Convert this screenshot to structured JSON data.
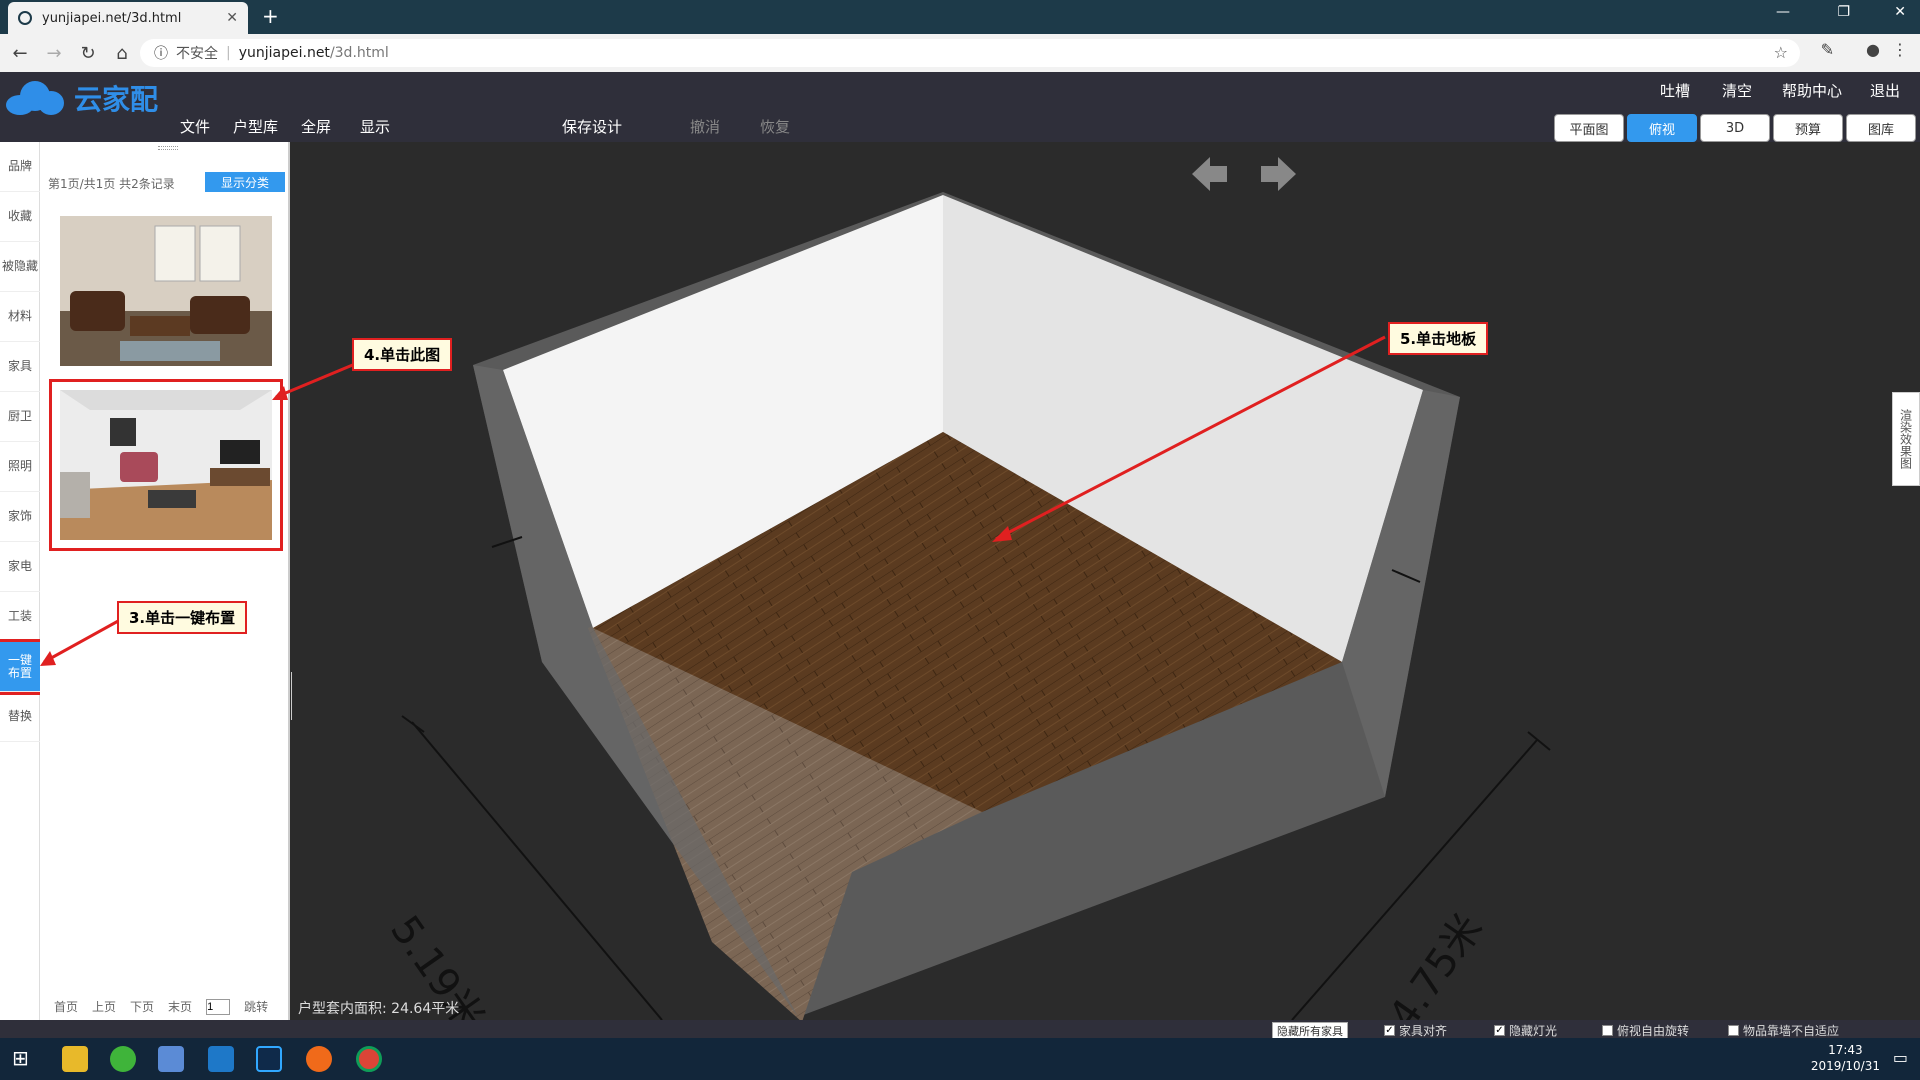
{
  "browser": {
    "tab_title": "yunjiapei.net/3d.html",
    "security_label": "不安全",
    "url_host": "yunjiapei.net",
    "url_path": "/3d.html"
  },
  "app": {
    "logo_text": "云家配",
    "menu": [
      "文件",
      "户型库",
      "全屏",
      "显示"
    ],
    "save": "保存设计",
    "undo": "撤消",
    "redo": "恢复",
    "top_links": [
      "吐槽",
      "清空",
      "帮助中心",
      "退出"
    ],
    "view_tabs": [
      "平面图",
      "俯视",
      "3D",
      "预算",
      "图库"
    ],
    "active_view": "俯视"
  },
  "sidebar": {
    "categories": [
      "品牌",
      "收藏",
      "被隐藏",
      "材料",
      "家具",
      "厨卫",
      "照明",
      "家饰",
      "家电",
      "工装",
      "一键布置",
      "替换"
    ],
    "active": "一键布置"
  },
  "list": {
    "page_info": "第1页/共1页 共2条记录",
    "show_category": "显示分类",
    "pager": {
      "first": "首页",
      "prev": "上页",
      "next": "下页",
      "last": "末页",
      "page_value": "1",
      "jump": "跳转"
    }
  },
  "viewport": {
    "area_text": "户型套内面积: 24.64平米",
    "dim_left": "5.19米",
    "dim_right": "4.75米",
    "side_tab": "渲染效果图"
  },
  "bottom": {
    "hide_all": "隐藏所有家具",
    "options": [
      {
        "label": "家具对齐",
        "checked": true
      },
      {
        "label": "隐藏灯光",
        "checked": true
      },
      {
        "label": "俯视自由旋转",
        "checked": false
      },
      {
        "label": "物品靠墙不自适应",
        "checked": false
      }
    ]
  },
  "callouts": {
    "step3": "3.单击一键布置",
    "step4": "4.单击此图",
    "step5": "5.单击地板"
  },
  "taskbar": {
    "time": "17:43",
    "date": "2019/10/31"
  },
  "colors": {
    "accent": "#3399ee",
    "callout_border": "#e02020",
    "header_bg": "#2f2f3a"
  }
}
